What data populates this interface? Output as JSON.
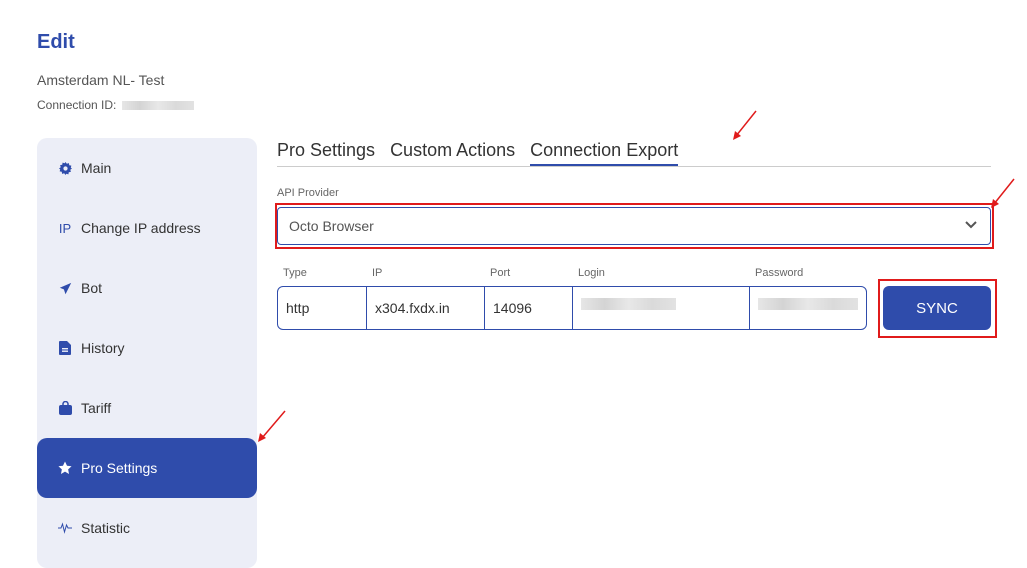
{
  "header": {
    "title": "Edit",
    "connection_name": "Amsterdam NL- Test",
    "connection_id_label": "Connection ID:"
  },
  "sidebar": {
    "items": [
      {
        "label": "Main",
        "icon": "gear-icon"
      },
      {
        "label": "Change IP address",
        "icon": "ip-icon",
        "icon_text": "IP"
      },
      {
        "label": "Bot",
        "icon": "paper-plane-icon"
      },
      {
        "label": "History",
        "icon": "document-icon"
      },
      {
        "label": "Tariff",
        "icon": "shopping-bag-icon"
      },
      {
        "label": "Pro Settings",
        "icon": "star-icon",
        "active": true
      },
      {
        "label": "Statistic",
        "icon": "pulse-icon"
      }
    ]
  },
  "tabs": [
    {
      "label": "Pro Settings"
    },
    {
      "label": "Custom Actions"
    },
    {
      "label": "Connection Export",
      "active": true
    }
  ],
  "api_provider": {
    "label": "API Provider",
    "value": "Octo Browser"
  },
  "proxy": {
    "columns": [
      "Type",
      "IP",
      "Port",
      "Login",
      "Password"
    ],
    "values": {
      "type": "http",
      "ip": "x304.fxdx.in",
      "port": "14096"
    }
  },
  "sync_button": {
    "label": "SYNC"
  },
  "colors": {
    "accent": "#2f4cab",
    "sidebar_bg": "#eceef7",
    "annotation_red": "#e01b1b"
  }
}
